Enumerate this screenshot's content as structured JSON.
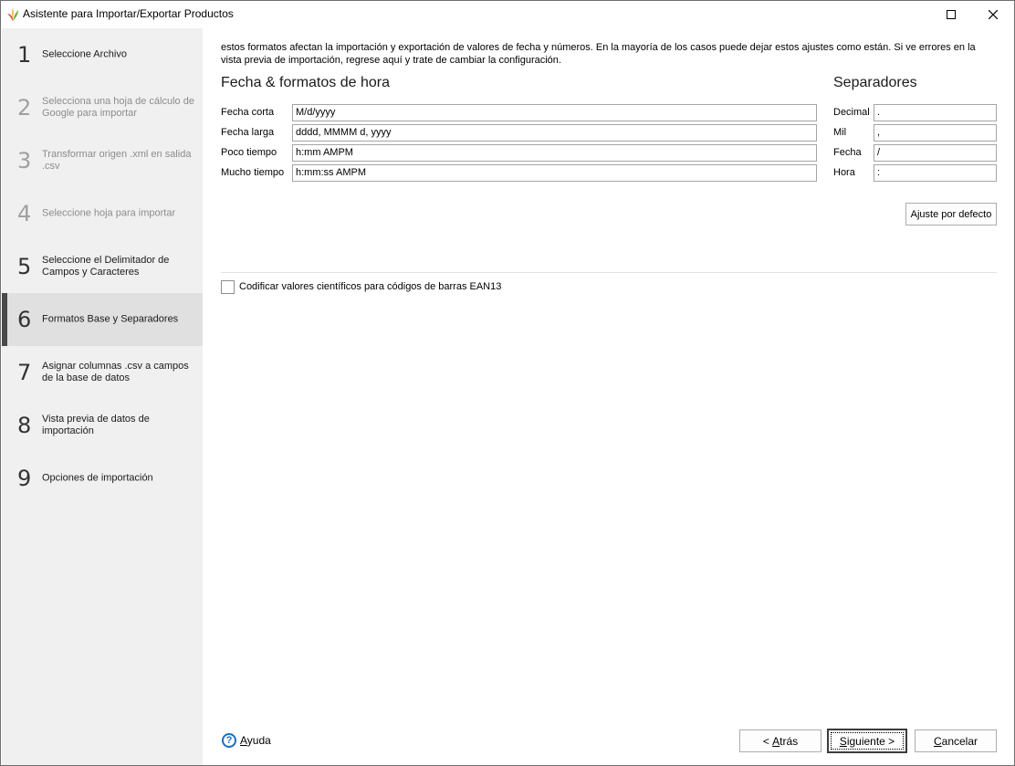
{
  "window": {
    "title": "Asistente para Importar/Exportar Productos",
    "maximize_glyph": "□",
    "close_glyph": "✕"
  },
  "sidebar": {
    "steps": [
      {
        "num": "1",
        "label": "Seleccione Archivo",
        "state": "enabled"
      },
      {
        "num": "2",
        "label": "Selecciona una hoja de cálculo de Google para importar",
        "state": "disabled"
      },
      {
        "num": "3",
        "label": "Transformar origen .xml en salida .csv",
        "state": "disabled"
      },
      {
        "num": "4",
        "label": "Seleccione hoja para importar",
        "state": "disabled"
      },
      {
        "num": "5",
        "label": "Seleccione el Delimitador de Campos y Caracteres",
        "state": "enabled"
      },
      {
        "num": "6",
        "label": "Formatos Base y Separadores",
        "state": "active"
      },
      {
        "num": "7",
        "label": "Asignar columnas .csv a campos de la base de datos",
        "state": "enabled"
      },
      {
        "num": "8",
        "label": "Vista previa de datos de importación",
        "state": "enabled"
      },
      {
        "num": "9",
        "label": "Opciones de importación",
        "state": "enabled"
      }
    ]
  },
  "main": {
    "intro": "estos formatos afectan la importación y exportación de valores de fecha y números. En la mayoría de los casos puede dejar estos ajustes como están. Si ve errores en la vista previa de importación, regrese aquí y trate de cambiar la configuración.",
    "date_section": {
      "title": "Fecha & formatos de hora",
      "fields": [
        {
          "label": "Fecha corta",
          "value": "M/d/yyyy"
        },
        {
          "label": "Fecha larga",
          "value": "dddd, MMMM d, yyyy"
        },
        {
          "label": "Poco tiempo",
          "value": "h:mm AMPM"
        },
        {
          "label": "Mucho tiempo",
          "value": "h:mm:ss AMPM"
        }
      ]
    },
    "separators_section": {
      "title": "Separadores",
      "fields": [
        {
          "label": "Decimal",
          "value": "."
        },
        {
          "label": "Mil",
          "value": ","
        },
        {
          "label": "Fecha",
          "value": "/"
        },
        {
          "label": "Hora",
          "value": ":"
        }
      ]
    },
    "default_button": "Ajuste por defecto",
    "ean13_checkbox": {
      "label": "Codificar valores científicos para códigos de barras EAN13",
      "checked": false
    }
  },
  "footer": {
    "help_icon_glyph": "?",
    "help_label_mnemonic": "A",
    "help_label_rest": "yuda",
    "back_prefix": "< ",
    "back_mnemonic": "A",
    "back_rest": "trás",
    "next_mnemonic": "S",
    "next_rest": "iguiente >",
    "cancel_mnemonic": "C",
    "cancel_rest": "ancelar"
  }
}
